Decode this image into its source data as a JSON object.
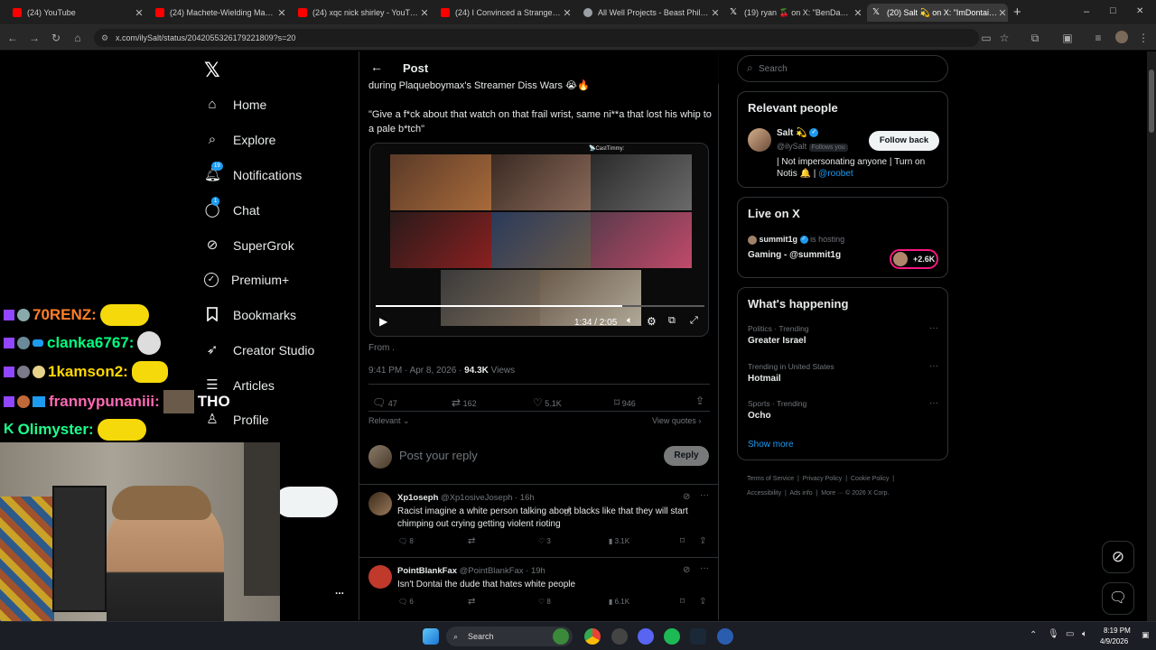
{
  "browser": {
    "tabs": [
      {
        "title": "(24) YouTube",
        "color": "#ff0000"
      },
      {
        "title": "(24) Machete-Wielding Man Tri",
        "color": "#ff0000"
      },
      {
        "title": "(24) xqc nick shirley - YouTube",
        "color": "#ff0000"
      },
      {
        "title": "(24) I Convinced a Stranger to F",
        "color": "#ff0000"
      },
      {
        "title": "All Well Projects - Beast Philant",
        "color": "#9aa0a6"
      },
      {
        "title": "(19) ryan 🍒 on X: \"BenDaDonn",
        "color": "#e7e9ea"
      },
      {
        "title": "(20) Salt 💫 on X: \"ImDontai di",
        "color": "#e7e9ea"
      }
    ],
    "new_tab": "+",
    "url": "x.com/ilySalt/status/2042055326179221809?s=20",
    "window_controls": [
      "–",
      "□",
      "✕"
    ]
  },
  "xnav": {
    "logo": "𝕏",
    "items": [
      {
        "label": "Home",
        "icon": "home-icon",
        "glyph": "⌂"
      },
      {
        "label": "Explore",
        "icon": "search-icon",
        "glyph": "⌕"
      },
      {
        "label": "Notifications",
        "icon": "bell-icon",
        "glyph": "♫",
        "badge": "19"
      },
      {
        "label": "Chat",
        "icon": "chat-icon",
        "glyph": "◯",
        "badge": "1"
      },
      {
        "label": "SuperGrok",
        "icon": "grok-icon",
        "glyph": "⊘"
      },
      {
        "label": "Premium+",
        "icon": "premium-icon",
        "glyph": "✓"
      },
      {
        "label": "Bookmarks",
        "icon": "bookmark-icon",
        "glyph": "⌑"
      },
      {
        "label": "Creator Studio",
        "icon": "rocket-icon",
        "glyph": "➶"
      },
      {
        "label": "Articles",
        "icon": "articles-icon",
        "glyph": "☰"
      },
      {
        "label": "Profile",
        "icon": "profile-icon",
        "glyph": "♙"
      }
    ],
    "more": "..."
  },
  "post": {
    "header": "Post",
    "text_top": "during Plaqueboymax's Streamer Diss Wars 😭🔥",
    "quote": "\"Give a f*ck about that watch on that frail wrist, same ni**a that lost his whip to a pale b*tch\"",
    "video_overlay": "📡CastTimmy:",
    "video_time": "1:34 / 2:05",
    "video_progress": 0.75,
    "from": "From .",
    "timestamp": "9:41 PM · Apr 8, 2026 ·",
    "views_count": "94.3K",
    "views_label": "Views",
    "stats": {
      "replies": "47",
      "reposts": "162",
      "likes": "5.1K",
      "bookmarks": "946"
    },
    "sort": "Relevant",
    "view_quotes": "View quotes",
    "reply_placeholder": "Post your reply",
    "reply_button": "Reply"
  },
  "replies": [
    {
      "name": "Xp1oseph",
      "handle": "@Xp1osiveJoseph · 16h",
      "text": "Racist imagine a white person talking about blacks like that they will start chimping out crying getting violent rioting",
      "replies": "8",
      "reposts": "",
      "likes": "3",
      "views": "3.1K"
    },
    {
      "name": "PointBlankFax",
      "handle": "@PointBlankFax · 19h",
      "text": "Isn't Dontai the dude that hates white people",
      "replies": "6",
      "reposts": "",
      "likes": "8",
      "views": "6.1K"
    }
  ],
  "sidebar": {
    "search_placeholder": "Search",
    "relevant_title": "Relevant people",
    "person_name": "Salt 💫",
    "person_handle": "@ilySalt",
    "follows_you": "Follows you",
    "follow_back": "Follow back",
    "person_bio": "| Not impersonating anyone | Turn on Notis 🔔 |",
    "person_bio_link": "@roobet",
    "live_title": "Live on X",
    "live_host": "summit1g",
    "live_hosting": "is hosting",
    "live_stream": "Gaming - @summit1g",
    "live_count": "+2.6K",
    "happening_title": "What's happening",
    "trends": [
      {
        "context": "Politics · Trending",
        "name": "Greater Israel"
      },
      {
        "context": "Trending in United States",
        "name": "Hotmail"
      },
      {
        "context": "Sports · Trending",
        "name": "Ocho"
      }
    ],
    "show_more": "Show more",
    "footer": [
      "Terms of Service",
      "Privacy Policy",
      "Cookie Policy",
      "Accessibility",
      "Ads info",
      "More ···",
      "© 2026 X Corp."
    ]
  },
  "chat_overlay": [
    {
      "user": "70RENZ:",
      "color": "#ff7f27"
    },
    {
      "user": "clanka6767:",
      "color": "#00ff7f"
    },
    {
      "user": "1kamson2:",
      "color": "#ffd700"
    },
    {
      "user": "frannypunaniii:",
      "color": "#ff69b4",
      "message": "THO"
    },
    {
      "user": "Olimyster:",
      "color": "#1eff8c"
    }
  ],
  "taskbar": {
    "search": "Search",
    "time": "8:19 PM",
    "date": "4/9/2026"
  },
  "colors": {
    "accent": "#1d9bf0",
    "live": "#f91880"
  }
}
